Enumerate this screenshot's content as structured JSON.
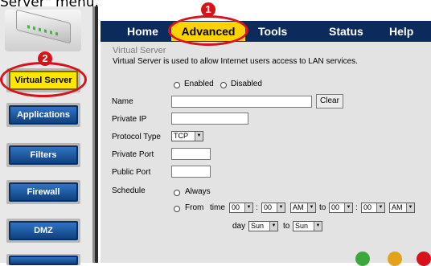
{
  "caption": "Server\" menu.",
  "nav": {
    "tabs": [
      {
        "label": "Home"
      },
      {
        "label": "Advanced"
      },
      {
        "label": "Tools"
      },
      {
        "label": "Status"
      },
      {
        "label": "Help"
      }
    ],
    "sidebar": [
      {
        "label": "Virtual Server"
      },
      {
        "label": "Applications"
      },
      {
        "label": "Filters"
      },
      {
        "label": "Firewall"
      },
      {
        "label": "DMZ"
      }
    ]
  },
  "annotations": {
    "tab_marker": "1",
    "sidebar_marker": "2"
  },
  "page": {
    "title": "Virtual Server",
    "description": "Virtual Server is used to allow Internet users access to LAN services."
  },
  "form": {
    "enabled_label": "Enabled",
    "disabled_label": "Disabled",
    "name_label": "Name",
    "name_value": "",
    "clear_label": "Clear",
    "private_ip_label": "Private IP",
    "private_ip_value": "",
    "protocol_label": "Protocol Type",
    "protocol_value": "TCP",
    "private_port_label": "Private Port",
    "private_port_value": "",
    "public_port_label": "Public Port",
    "public_port_value": "",
    "schedule_label": "Schedule",
    "always_label": "Always",
    "from_label": "From",
    "time_label": "time",
    "time_from_hour": "00",
    "time_from_min": "00",
    "time_from_ampm": "AM",
    "to_label": "to",
    "time_to_hour": "00",
    "time_to_min": "00",
    "time_to_ampm": "AM",
    "colon": ":",
    "day_label": "day",
    "day_from": "Sun",
    "day_to": "Sun"
  },
  "colors": {
    "accent": "#ffd200",
    "nav_dark": "#0c2a5b",
    "marker_red": "#d6131b"
  }
}
